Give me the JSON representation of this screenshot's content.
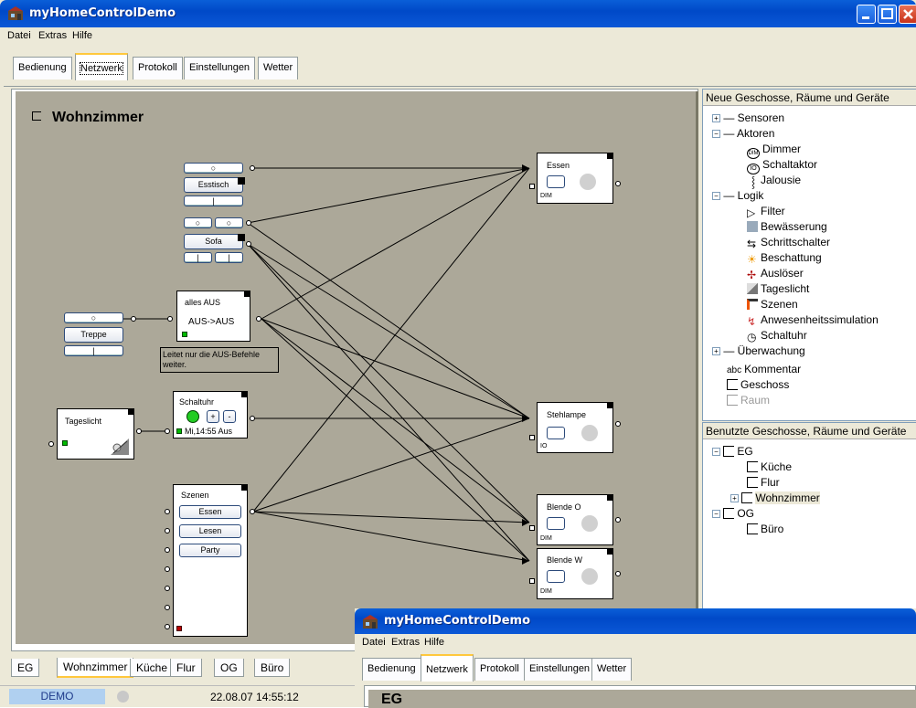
{
  "window": {
    "title": "myHomeControlDemo"
  },
  "menu": [
    "Datei",
    "Extras",
    "Hilfe"
  ],
  "tabs": [
    "Bedienung",
    "Netzwerk",
    "Protokoll",
    "Einstellungen",
    "Wetter"
  ],
  "canvas": {
    "room_title": "Wohnzimmer",
    "blocks": {
      "esstisch": "Esstisch",
      "sofa": "Sofa",
      "treppe": "Treppe",
      "alles_aus_title": "alles AUS",
      "alles_aus_body": "AUS->AUS",
      "note": "Leitet nur die AUS-Befehle weiter.",
      "tageslicht": "Tageslicht",
      "schaltuhr_title": "Schaltuhr",
      "schaltuhr_time": "Mi,14:55 Aus",
      "szenen_title": "Szenen",
      "szenen_buttons": [
        "Essen",
        "Lesen",
        "Party"
      ],
      "essen": "Essen",
      "essen_type": "DIM",
      "stehlampe": "Stehlampe",
      "stehlampe_type": "IO",
      "blende_o": "Blende O",
      "blende_o_type": "DIM",
      "blende_w": "Blende W",
      "blende_w_type": "DIM"
    }
  },
  "palette": {
    "header": "Neue Geschosse, Räume und Geräte",
    "sensoren": "Sensoren",
    "aktoren": "Aktoren",
    "aktoren_items": [
      "Dimmer",
      "Schaltaktor",
      "Jalousie"
    ],
    "logik": "Logik",
    "logik_items": [
      "Filter",
      "Bewässerung",
      "Schrittschalter",
      "Beschattung",
      "Auslöser",
      "Tageslicht",
      "Szenen",
      "Anwesenheitssimulation",
      "Schaltuhr"
    ],
    "ueberwachung": "Überwachung",
    "other_items": [
      "Kommentar",
      "Geschoss",
      "Raum"
    ],
    "icon_labels": {
      "dim": "DIM",
      "io": "IO",
      "abc": "abc"
    }
  },
  "used": {
    "header": "Benutzte Geschosse, Räume und Geräte",
    "eg": "EG",
    "eg_rooms": [
      "Küche",
      "Flur",
      "Wohnzimmer"
    ],
    "og": "OG",
    "og_rooms": [
      "Büro"
    ]
  },
  "bottom_tabs": [
    "EG",
    "Wohnzimmer",
    "Küche",
    "Flur",
    "OG",
    "Büro"
  ],
  "status": {
    "mode": "DEMO",
    "datetime": "22.08.07  14:55:12"
  },
  "second_window": {
    "title": "myHomeControlDemo",
    "menu": [
      "Datei",
      "Extras",
      "Hilfe"
    ],
    "tabs": [
      "Bedienung",
      "Netzwerk",
      "Protokoll",
      "Einstellungen",
      "Wetter"
    ],
    "partial_title": "EG"
  },
  "colors": {
    "canvas_bg": "#aca899",
    "title_blue": "#0049c8",
    "led_green": "#00bb00",
    "chrome": "#ece9d8"
  }
}
